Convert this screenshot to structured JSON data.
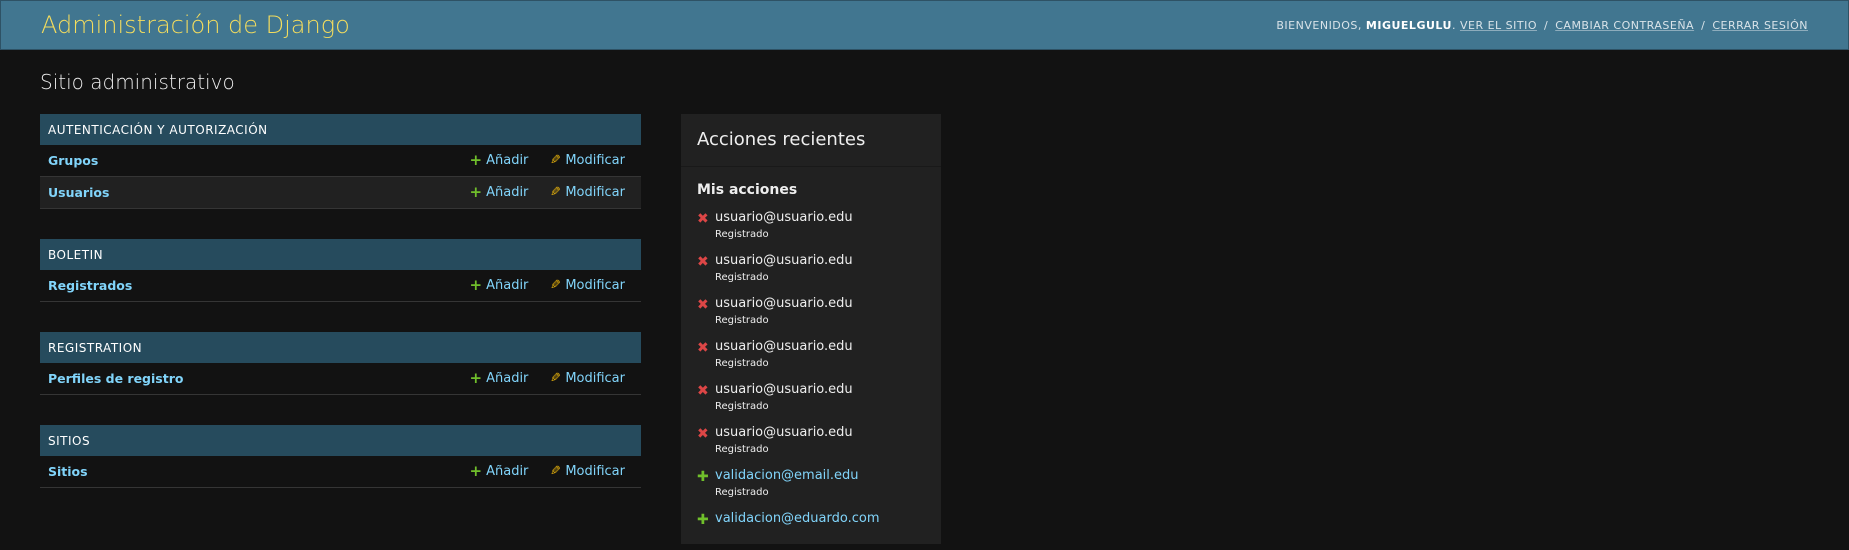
{
  "header": {
    "branding": "Administración de Django",
    "welcome": "Bienvenidos,",
    "username": "miguelgulu",
    "links": [
      "Ver el sitio",
      "Cambiar contraseña",
      "Cerrar sesión"
    ]
  },
  "page_title": "Sitio administrativo",
  "apps": [
    {
      "caption": "Autenticación y autorización",
      "models": [
        {
          "name": "Grupos"
        },
        {
          "name": "Usuarios"
        }
      ]
    },
    {
      "caption": "Boletin",
      "models": [
        {
          "name": "Registrados"
        }
      ]
    },
    {
      "caption": "Registration",
      "models": [
        {
          "name": "Perfiles de registro"
        }
      ]
    },
    {
      "caption": "Sitios",
      "models": [
        {
          "name": "Sitios"
        }
      ]
    }
  ],
  "labels": {
    "add": "Añadir",
    "change": "Modificar"
  },
  "recent": {
    "title": "Acciones recientes",
    "subtitle": "Mis acciones",
    "items": [
      {
        "text": "usuario@usuario.edu",
        "type": "Registrado",
        "kind": "delete"
      },
      {
        "text": "usuario@usuario.edu",
        "type": "Registrado",
        "kind": "delete"
      },
      {
        "text": "usuario@usuario.edu",
        "type": "Registrado",
        "kind": "delete"
      },
      {
        "text": "usuario@usuario.edu",
        "type": "Registrado",
        "kind": "delete"
      },
      {
        "text": "usuario@usuario.edu",
        "type": "Registrado",
        "kind": "delete"
      },
      {
        "text": "usuario@usuario.edu",
        "type": "Registrado",
        "kind": "delete"
      },
      {
        "text": "validacion@email.edu",
        "type": "Registrado",
        "kind": "add"
      },
      {
        "text": "validacion@eduardo.com",
        "type": "",
        "kind": "add"
      }
    ]
  },
  "icons": {
    "add": "plus-icon",
    "change": "pencil-icon",
    "delete": "x-icon"
  },
  "colors": {
    "header_bg": "#417690",
    "branding": "#f5dd5d",
    "caption_bg": "#264b5d",
    "link": "#81d4fa",
    "add": "#70bf2b",
    "change": "#efb80b",
    "delete": "#dd4646"
  }
}
